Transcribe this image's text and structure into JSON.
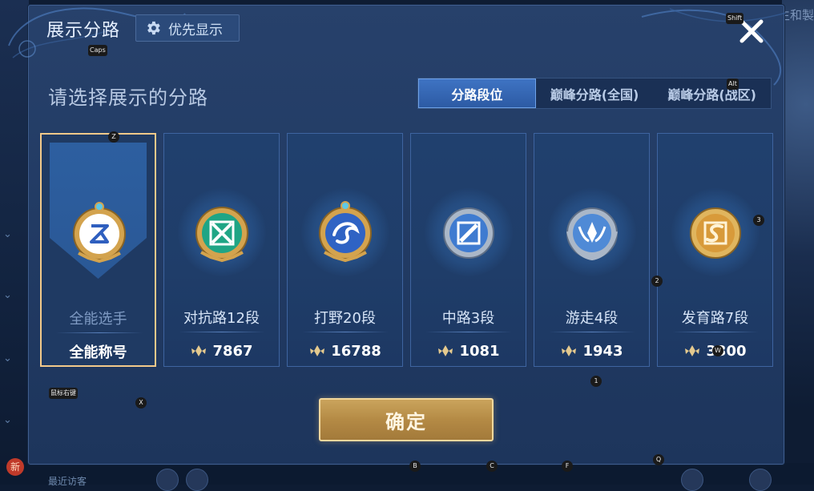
{
  "background": {
    "right_edge_text": "生和製",
    "new_badge": "新",
    "bottom_text": "最近访客"
  },
  "dialog": {
    "title": "展示分路",
    "priority_button": "优先显示",
    "subtitle": "请选择展示的分路",
    "tabs": [
      {
        "label": "分路段位",
        "active": true
      },
      {
        "label": "巅峰分路(全国)",
        "active": false
      },
      {
        "label": "巅峰分路(战区)",
        "active": false
      }
    ],
    "cards": [
      {
        "name": "全能选手",
        "footer": "全能称号",
        "selected": true,
        "emblem": "allround-emblem-icon"
      },
      {
        "name": "对抗路12段",
        "score": "7867",
        "selected": false,
        "emblem": "clash-lane-emblem-icon"
      },
      {
        "name": "打野20段",
        "score": "16788",
        "selected": false,
        "emblem": "jungle-emblem-icon"
      },
      {
        "name": "中路3段",
        "score": "1081",
        "selected": false,
        "emblem": "mid-lane-emblem-icon"
      },
      {
        "name": "游走4段",
        "score": "1943",
        "selected": false,
        "emblem": "roam-emblem-icon"
      },
      {
        "name": "发育路7段",
        "score": "3300",
        "selected": false,
        "emblem": "farm-lane-emblem-icon"
      }
    ],
    "confirm_label": "确定"
  },
  "key_hints": {
    "caps": "Caps",
    "shift": "Shift",
    "alt": "Alt",
    "z": "Z",
    "three": "3",
    "two": "2",
    "one": "1",
    "w": "W",
    "mouse_move": "鼠标右键",
    "x": "X",
    "b": "B",
    "c": "C",
    "f": "F",
    "q": "Q"
  },
  "colors": {
    "dialog_bg": "#213a63",
    "active_tab": "#3f74c4",
    "selected_border": "#f2c98a",
    "confirm_gold": "#b48a45"
  }
}
